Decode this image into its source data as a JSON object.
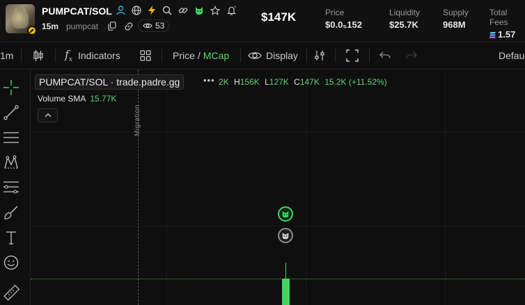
{
  "header": {
    "pair": "PUMPCAT/SOL",
    "age": "15m",
    "ticker": "pumpcat",
    "watchers": "53",
    "market_cap": "$147K",
    "stats": [
      {
        "label": "Price",
        "value": "$0.0₅152"
      },
      {
        "label": "Liquidity",
        "value": "$25.7K"
      },
      {
        "label": "Supply",
        "value": "968M"
      },
      {
        "label": "Total Fees",
        "value": "1.57"
      }
    ],
    "icons": [
      "user-icon",
      "globe-icon",
      "lightning-icon",
      "search-icon",
      "link-icon",
      "cat-icon",
      "star-icon",
      "bell-icon"
    ],
    "colors": {
      "accent_green": "#5ad66f",
      "teal": "#2fb4d6",
      "gold": "#f0b90b"
    }
  },
  "toolbar": {
    "interval": "1m",
    "indicators": "Indicators",
    "price": "Price",
    "slash": "/",
    "mcap": "MCap",
    "display": "Display",
    "layout": "Defau"
  },
  "chart": {
    "legend_pair": "PUMPCAT/SOL · trade.padre.gg",
    "more": "•••",
    "ohlc": {
      "o_tail": "2K",
      "h_label": "H",
      "h": "156K",
      "l_label": "L",
      "l": "127K",
      "c_label": "C",
      "c": "147K",
      "change": "15.2K (+11.52%)"
    },
    "volume_label": "Volume SMA",
    "volume_value": "15.77K",
    "migration_label": "Migration"
  }
}
